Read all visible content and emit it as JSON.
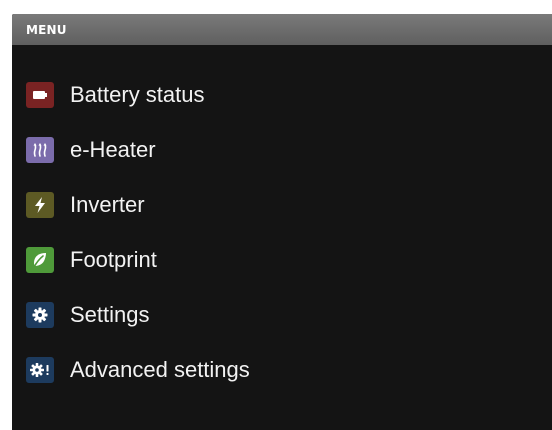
{
  "header": {
    "title": "MENU"
  },
  "menu": {
    "items": [
      {
        "label": "Battery status",
        "icon": "battery-icon",
        "color": "#7a2323"
      },
      {
        "label": "e-Heater",
        "icon": "heater-icon",
        "color": "#7b6cab"
      },
      {
        "label": "Inverter",
        "icon": "lightning-icon",
        "color": "#5d5a24"
      },
      {
        "label": "Footprint",
        "icon": "leaf-icon",
        "color": "#4f9a3a"
      },
      {
        "label": "Settings",
        "icon": "gear-icon",
        "color": "#1d3b5e"
      },
      {
        "label": "Advanced settings",
        "icon": "gear-exclamation-icon",
        "color": "#1d3b5e"
      }
    ]
  }
}
